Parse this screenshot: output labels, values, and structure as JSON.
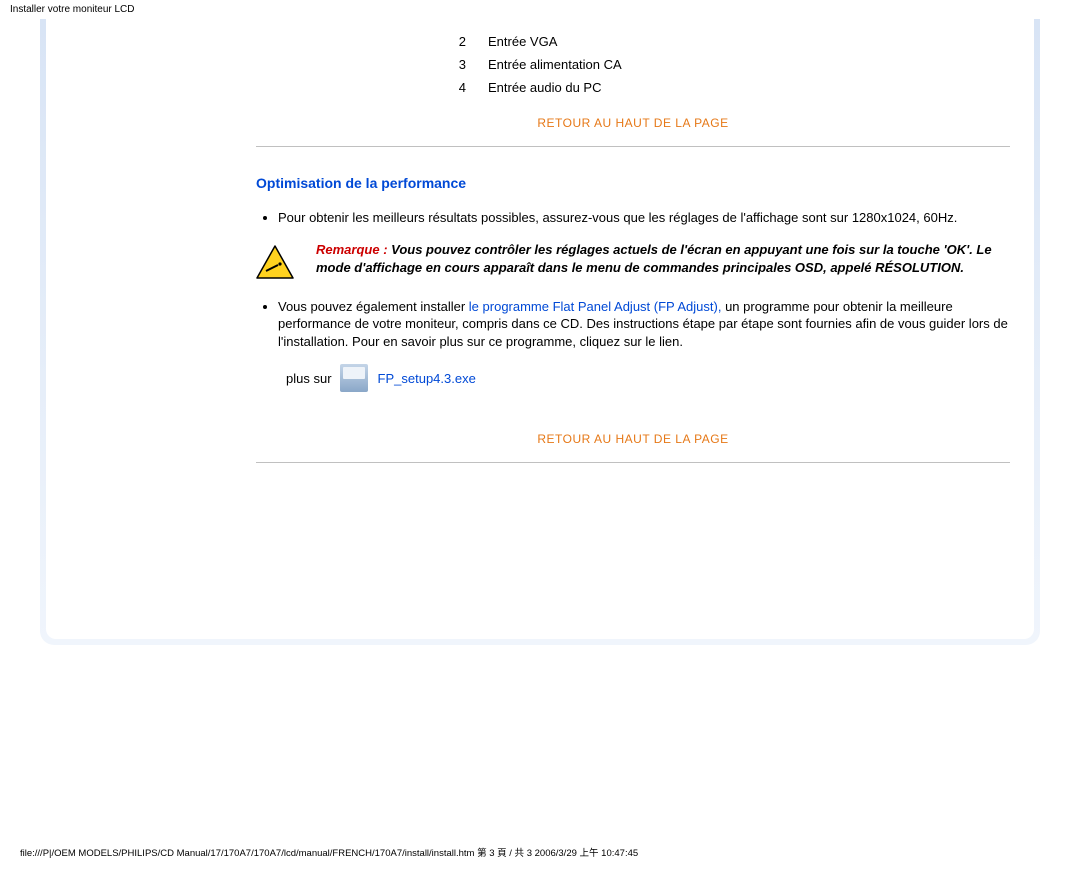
{
  "page_header": "Installer votre moniteur LCD",
  "numbered_items": [
    {
      "n": "2",
      "label": "Entrée VGA"
    },
    {
      "n": "3",
      "label": "Entrée alimentation CA"
    },
    {
      "n": "4",
      "label": "Entrée audio du PC"
    }
  ],
  "top_link": "RETOUR AU HAUT DE LA PAGE",
  "section_title": "Optimisation de la performance",
  "bullet1": "Pour obtenir les meilleurs résultats possibles, assurez-vous que les réglages de l'affichage sont sur 1280x1024, 60Hz.",
  "note": {
    "label": "Remarque : ",
    "body": "Vous pouvez contrôler les réglages actuels de l'écran en appuyant une fois sur la touche 'OK'. Le mode d'affichage en cours apparaît dans le menu de commandes principales OSD, appelé RÉSOLUTION."
  },
  "bullet2_pre": "Vous pouvez également installer ",
  "bullet2_link": "le programme Flat Panel Adjust (FP Adjust),",
  "bullet2_post": " un programme pour obtenir la meilleure performance de votre moniteur, compris dans ce CD. Des instructions étape par étape sont fournies afin de vous guider lors de l'installation. Pour en savoir plus sur ce programme, cliquez sur le lien.",
  "plus_label": "plus sur",
  "file_link": "FP_setup4.3.exe",
  "footer": "file:///P|/OEM MODELS/PHILIPS/CD Manual/17/170A7/170A7/lcd/manual/FRENCH/170A7/install/install.htm 第 3 頁 / 共 3 2006/3/29 上午 10:47:45"
}
